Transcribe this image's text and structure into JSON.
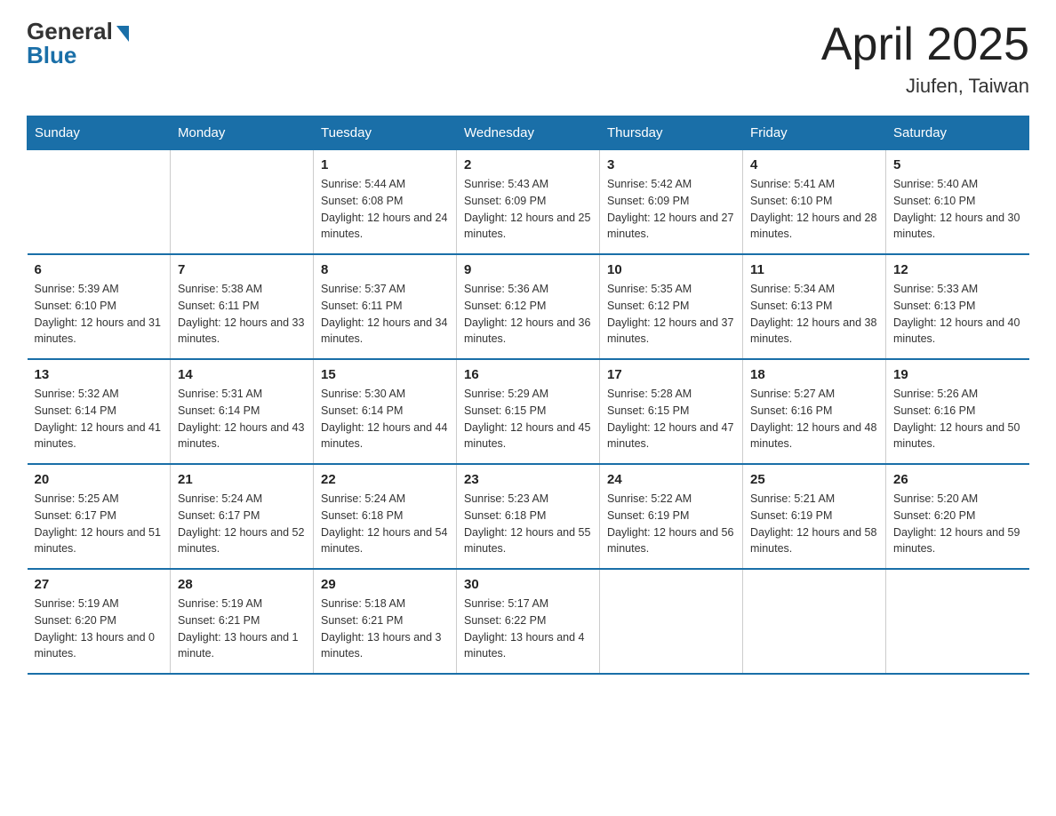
{
  "header": {
    "logo_general": "General",
    "logo_blue": "Blue",
    "month_title": "April 2025",
    "location": "Jiufen, Taiwan"
  },
  "weekdays": [
    "Sunday",
    "Monday",
    "Tuesday",
    "Wednesday",
    "Thursday",
    "Friday",
    "Saturday"
  ],
  "weeks": [
    [
      {
        "day": "",
        "sunrise": "",
        "sunset": "",
        "daylight": ""
      },
      {
        "day": "",
        "sunrise": "",
        "sunset": "",
        "daylight": ""
      },
      {
        "day": "1",
        "sunrise": "Sunrise: 5:44 AM",
        "sunset": "Sunset: 6:08 PM",
        "daylight": "Daylight: 12 hours and 24 minutes."
      },
      {
        "day": "2",
        "sunrise": "Sunrise: 5:43 AM",
        "sunset": "Sunset: 6:09 PM",
        "daylight": "Daylight: 12 hours and 25 minutes."
      },
      {
        "day": "3",
        "sunrise": "Sunrise: 5:42 AM",
        "sunset": "Sunset: 6:09 PM",
        "daylight": "Daylight: 12 hours and 27 minutes."
      },
      {
        "day": "4",
        "sunrise": "Sunrise: 5:41 AM",
        "sunset": "Sunset: 6:10 PM",
        "daylight": "Daylight: 12 hours and 28 minutes."
      },
      {
        "day": "5",
        "sunrise": "Sunrise: 5:40 AM",
        "sunset": "Sunset: 6:10 PM",
        "daylight": "Daylight: 12 hours and 30 minutes."
      }
    ],
    [
      {
        "day": "6",
        "sunrise": "Sunrise: 5:39 AM",
        "sunset": "Sunset: 6:10 PM",
        "daylight": "Daylight: 12 hours and 31 minutes."
      },
      {
        "day": "7",
        "sunrise": "Sunrise: 5:38 AM",
        "sunset": "Sunset: 6:11 PM",
        "daylight": "Daylight: 12 hours and 33 minutes."
      },
      {
        "day": "8",
        "sunrise": "Sunrise: 5:37 AM",
        "sunset": "Sunset: 6:11 PM",
        "daylight": "Daylight: 12 hours and 34 minutes."
      },
      {
        "day": "9",
        "sunrise": "Sunrise: 5:36 AM",
        "sunset": "Sunset: 6:12 PM",
        "daylight": "Daylight: 12 hours and 36 minutes."
      },
      {
        "day": "10",
        "sunrise": "Sunrise: 5:35 AM",
        "sunset": "Sunset: 6:12 PM",
        "daylight": "Daylight: 12 hours and 37 minutes."
      },
      {
        "day": "11",
        "sunrise": "Sunrise: 5:34 AM",
        "sunset": "Sunset: 6:13 PM",
        "daylight": "Daylight: 12 hours and 38 minutes."
      },
      {
        "day": "12",
        "sunrise": "Sunrise: 5:33 AM",
        "sunset": "Sunset: 6:13 PM",
        "daylight": "Daylight: 12 hours and 40 minutes."
      }
    ],
    [
      {
        "day": "13",
        "sunrise": "Sunrise: 5:32 AM",
        "sunset": "Sunset: 6:14 PM",
        "daylight": "Daylight: 12 hours and 41 minutes."
      },
      {
        "day": "14",
        "sunrise": "Sunrise: 5:31 AM",
        "sunset": "Sunset: 6:14 PM",
        "daylight": "Daylight: 12 hours and 43 minutes."
      },
      {
        "day": "15",
        "sunrise": "Sunrise: 5:30 AM",
        "sunset": "Sunset: 6:14 PM",
        "daylight": "Daylight: 12 hours and 44 minutes."
      },
      {
        "day": "16",
        "sunrise": "Sunrise: 5:29 AM",
        "sunset": "Sunset: 6:15 PM",
        "daylight": "Daylight: 12 hours and 45 minutes."
      },
      {
        "day": "17",
        "sunrise": "Sunrise: 5:28 AM",
        "sunset": "Sunset: 6:15 PM",
        "daylight": "Daylight: 12 hours and 47 minutes."
      },
      {
        "day": "18",
        "sunrise": "Sunrise: 5:27 AM",
        "sunset": "Sunset: 6:16 PM",
        "daylight": "Daylight: 12 hours and 48 minutes."
      },
      {
        "day": "19",
        "sunrise": "Sunrise: 5:26 AM",
        "sunset": "Sunset: 6:16 PM",
        "daylight": "Daylight: 12 hours and 50 minutes."
      }
    ],
    [
      {
        "day": "20",
        "sunrise": "Sunrise: 5:25 AM",
        "sunset": "Sunset: 6:17 PM",
        "daylight": "Daylight: 12 hours and 51 minutes."
      },
      {
        "day": "21",
        "sunrise": "Sunrise: 5:24 AM",
        "sunset": "Sunset: 6:17 PM",
        "daylight": "Daylight: 12 hours and 52 minutes."
      },
      {
        "day": "22",
        "sunrise": "Sunrise: 5:24 AM",
        "sunset": "Sunset: 6:18 PM",
        "daylight": "Daylight: 12 hours and 54 minutes."
      },
      {
        "day": "23",
        "sunrise": "Sunrise: 5:23 AM",
        "sunset": "Sunset: 6:18 PM",
        "daylight": "Daylight: 12 hours and 55 minutes."
      },
      {
        "day": "24",
        "sunrise": "Sunrise: 5:22 AM",
        "sunset": "Sunset: 6:19 PM",
        "daylight": "Daylight: 12 hours and 56 minutes."
      },
      {
        "day": "25",
        "sunrise": "Sunrise: 5:21 AM",
        "sunset": "Sunset: 6:19 PM",
        "daylight": "Daylight: 12 hours and 58 minutes."
      },
      {
        "day": "26",
        "sunrise": "Sunrise: 5:20 AM",
        "sunset": "Sunset: 6:20 PM",
        "daylight": "Daylight: 12 hours and 59 minutes."
      }
    ],
    [
      {
        "day": "27",
        "sunrise": "Sunrise: 5:19 AM",
        "sunset": "Sunset: 6:20 PM",
        "daylight": "Daylight: 13 hours and 0 minutes."
      },
      {
        "day": "28",
        "sunrise": "Sunrise: 5:19 AM",
        "sunset": "Sunset: 6:21 PM",
        "daylight": "Daylight: 13 hours and 1 minute."
      },
      {
        "day": "29",
        "sunrise": "Sunrise: 5:18 AM",
        "sunset": "Sunset: 6:21 PM",
        "daylight": "Daylight: 13 hours and 3 minutes."
      },
      {
        "day": "30",
        "sunrise": "Sunrise: 5:17 AM",
        "sunset": "Sunset: 6:22 PM",
        "daylight": "Daylight: 13 hours and 4 minutes."
      },
      {
        "day": "",
        "sunrise": "",
        "sunset": "",
        "daylight": ""
      },
      {
        "day": "",
        "sunrise": "",
        "sunset": "",
        "daylight": ""
      },
      {
        "day": "",
        "sunrise": "",
        "sunset": "",
        "daylight": ""
      }
    ]
  ]
}
